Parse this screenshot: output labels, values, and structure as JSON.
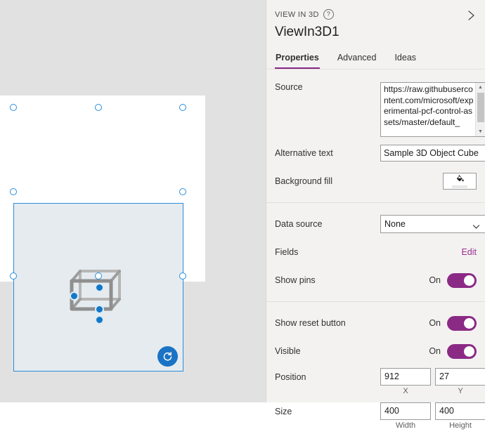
{
  "pane": {
    "eyebrow": "VIEW IN 3D",
    "help_icon": "help-circle-icon",
    "collapse_icon": "chevron-right-icon",
    "control_name": "ViewIn3D1",
    "tabs": [
      {
        "label": "Properties",
        "active": true
      },
      {
        "label": "Advanced",
        "active": false
      },
      {
        "label": "Ideas",
        "active": false
      }
    ],
    "properties": {
      "source": {
        "label": "Source",
        "value": "https://raw.githubusercontent.com/microsoft/experimental-pcf-control-assets/master/default_",
        "scroll_up_icon": "triangle-up-icon",
        "scroll_down_icon": "triangle-down-icon"
      },
      "alternative_text": {
        "label": "Alternative text",
        "value": "Sample 3D Object Cube"
      },
      "background_fill": {
        "label": "Background fill",
        "icon": "paint-bucket-icon",
        "swatch_color": "#e8e8e8"
      },
      "data_source": {
        "label": "Data source",
        "value": "None",
        "chevron_icon": "chevron-down-icon"
      },
      "fields": {
        "label": "Fields",
        "action": "Edit"
      },
      "show_pins": {
        "label": "Show pins",
        "state": "On"
      },
      "show_reset_button": {
        "label": "Show reset button",
        "state": "On"
      },
      "visible": {
        "label": "Visible",
        "state": "On"
      },
      "position": {
        "label": "Position",
        "x": "912",
        "y": "27",
        "x_label": "X",
        "y_label": "Y"
      },
      "size": {
        "label": "Size",
        "width": "400",
        "height": "400",
        "width_label": "Width",
        "height_label": "Height"
      }
    }
  },
  "canvas": {
    "control": {
      "name": "view-in-3d-control",
      "background_color": "#e6ebef",
      "selection_color": "#2a8ddb",
      "cube_icon": "3d-cube-wireframe-icon",
      "pins": [
        {
          "name": "pin-center"
        },
        {
          "name": "pin-lower"
        },
        {
          "name": "pin-bottom"
        },
        {
          "name": "pin-left"
        }
      ],
      "reset_button": {
        "icon": "reset-rotate-icon",
        "color": "#1a73c4"
      }
    }
  }
}
